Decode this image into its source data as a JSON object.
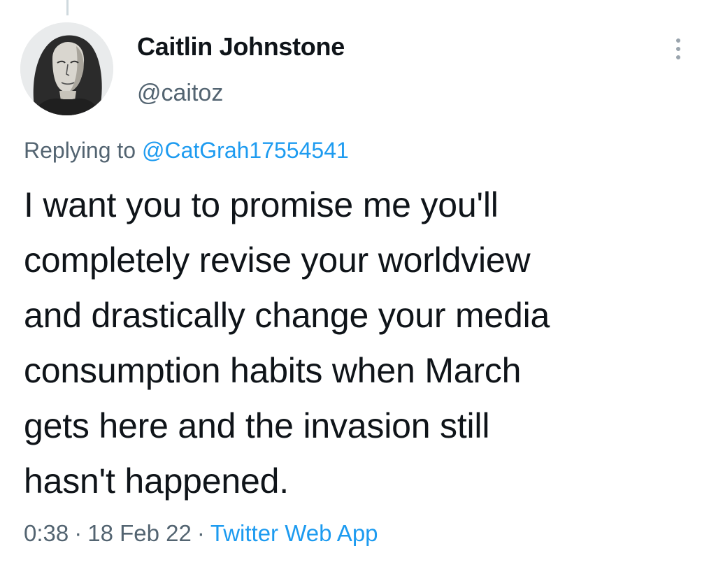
{
  "tweet": {
    "author": {
      "display_name": "Caitlin Johnstone",
      "handle": "@caitoz",
      "avatar_icon": "profile-avatar"
    },
    "more_icon": "more-vertical-icon",
    "reply": {
      "prefix": "Replying to",
      "mention": "@CatGrah17554541"
    },
    "text_lines": [
      "I want you to promise me you'll",
      "completely revise your worldview",
      "and drastically change your media",
      "consumption habits when March",
      "gets here and the invasion still",
      "hasn't happened."
    ],
    "meta": {
      "time": "0:38",
      "separator": "·",
      "date": "18 Feb 22",
      "source": "Twitter Web App"
    }
  },
  "colors": {
    "text": "#0f1419",
    "secondary": "#536471",
    "link": "#1d9bf0",
    "background": "#ffffff"
  }
}
